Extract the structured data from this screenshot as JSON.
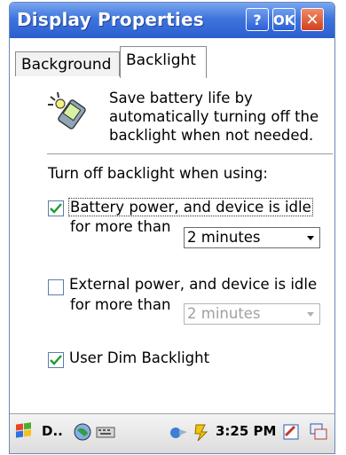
{
  "window": {
    "title": "Display Properties",
    "help_label": "?",
    "ok_label": "OK",
    "close_label": "✕"
  },
  "tabs": [
    {
      "label": "Background",
      "selected": false
    },
    {
      "label": "Backlight",
      "selected": true
    }
  ],
  "description": "Save battery life by automatically turning off the backlight when not needed.",
  "section_heading": "Turn off backlight when using:",
  "options": {
    "battery": {
      "checked": true,
      "label": "Battery power, and device is idle",
      "sub_label": "for more than",
      "select_value": "2 minutes",
      "enabled": true
    },
    "external": {
      "checked": false,
      "label": "External power, and device is idle",
      "sub_label": "for more than",
      "select_value": "2 minutes",
      "enabled": false
    },
    "user_dim": {
      "checked": true,
      "label": "User Dim Backlight"
    }
  },
  "taskbar": {
    "task_label": "D..",
    "time": "3:25 PM"
  },
  "colors": {
    "title_bar": "#3e74dd",
    "check_mark": "#1f9b2e"
  }
}
